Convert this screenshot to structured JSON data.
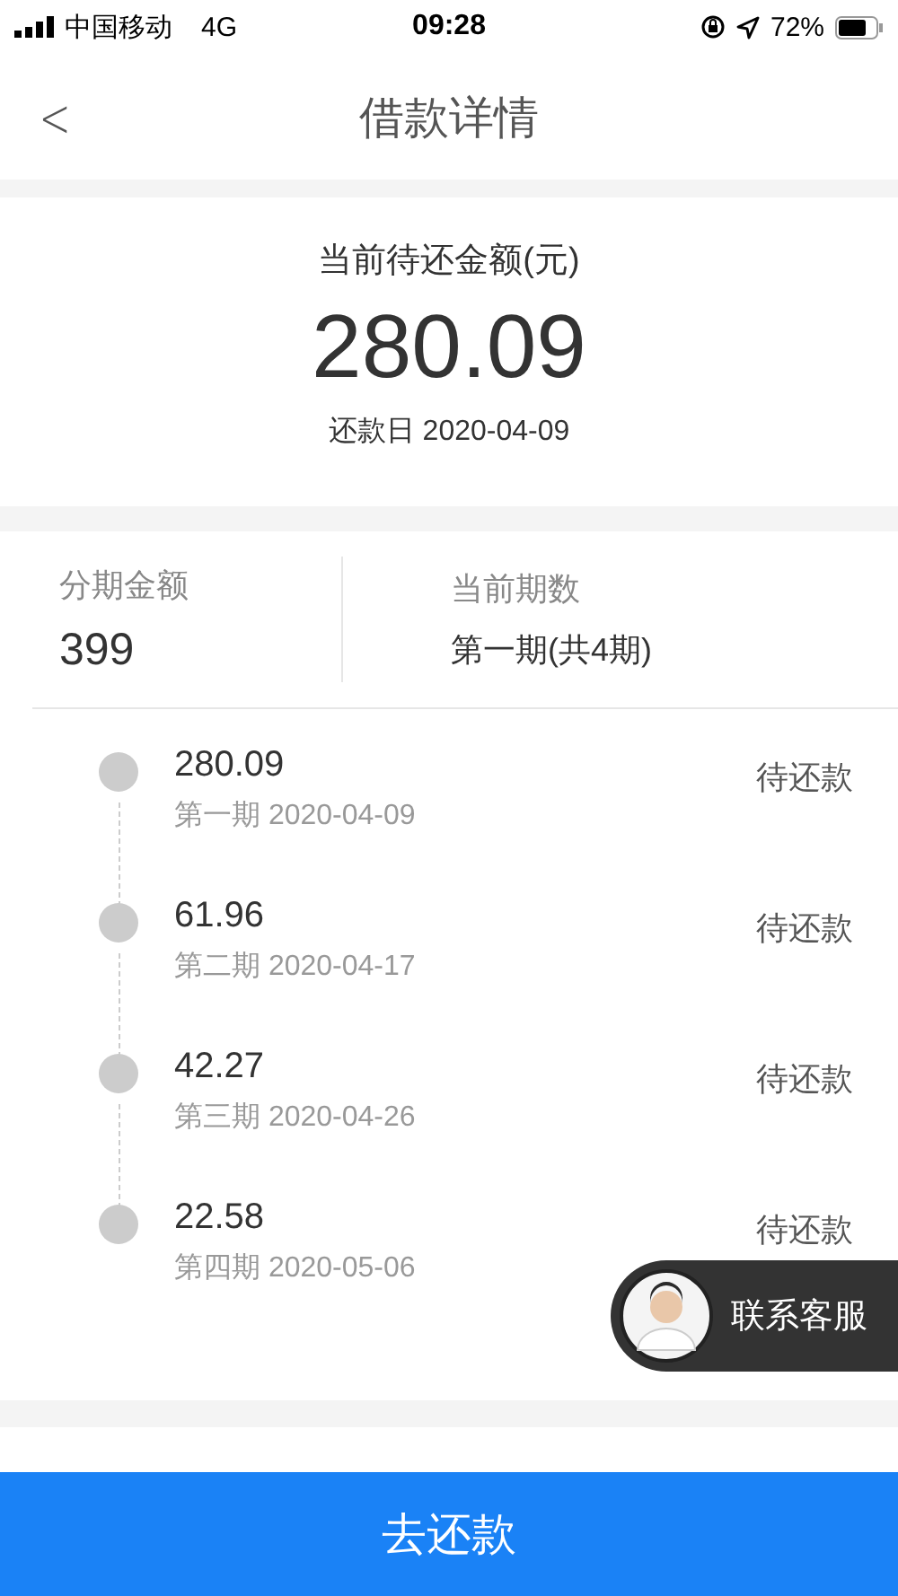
{
  "status_bar": {
    "carrier": "中国移动",
    "network": "4G",
    "time": "09:28",
    "battery": "72%"
  },
  "nav": {
    "back": "<",
    "title": "借款详情"
  },
  "summary": {
    "label": "当前待还金额(元)",
    "amount": "280.09",
    "due": "还款日 2020-04-09"
  },
  "info": [
    {
      "label": "分期金额",
      "value": "399"
    },
    {
      "label": "当前期数",
      "value": "第一期(共4期)"
    }
  ],
  "installments": [
    {
      "amount": "280.09",
      "period": "第一期 2020-04-09",
      "status": "待还款"
    },
    {
      "amount": "61.96",
      "period": "第二期 2020-04-17",
      "status": "待还款"
    },
    {
      "amount": "42.27",
      "period": "第三期 2020-04-26",
      "status": "待还款"
    },
    {
      "amount": "22.58",
      "period": "第四期 2020-05-06",
      "status": "待还款"
    }
  ],
  "contact": {
    "label": "联系客服"
  },
  "pay_button": {
    "label": "去还款"
  }
}
